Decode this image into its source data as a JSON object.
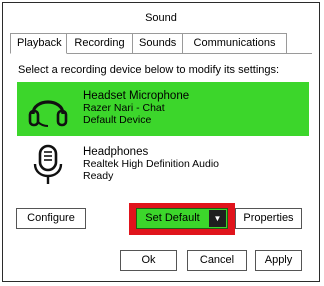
{
  "window": {
    "title": "Sound"
  },
  "tabs": [
    {
      "label": "Playback",
      "active": true
    },
    {
      "label": "Recording",
      "active": false
    },
    {
      "label": "Sounds",
      "active": false
    },
    {
      "label": "Communications",
      "active": false
    }
  ],
  "instruction": "Select a recording device below to modify its settings:",
  "devices": [
    {
      "icon": "headset-icon",
      "name": "Headset Microphone",
      "line2": "Razer Nari - Chat",
      "status": "Default Device",
      "selected": true
    },
    {
      "icon": "microphone-icon",
      "name": "Headphones",
      "line2": "Realtek High Definition Audio",
      "status": "Ready",
      "selected": false
    }
  ],
  "buttons": {
    "configure": "Configure",
    "set_default": "Set Default",
    "set_default_arrow": "▼",
    "properties": "Properties",
    "ok": "Ok",
    "cancel": "Cancel",
    "apply": "Apply"
  },
  "colors": {
    "selection": "#3cd62b",
    "highlight_box": "#e0141c",
    "arrow_bg": "#1f1f1f"
  }
}
